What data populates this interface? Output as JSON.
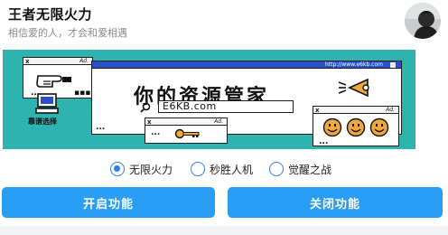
{
  "header": {
    "title": "王者无限火力",
    "subtitle": "相信爱的人，才会和爱相遇"
  },
  "banner": {
    "title": "你的资源管家",
    "url_input": "E6KB.com",
    "url_bar": "http://www.e6kb.com",
    "pc_label": "靠谱选择",
    "ad_label": "Ad.",
    "close_label": "x"
  },
  "modes": {
    "options": [
      "无限火力",
      "秒胜人机",
      "觉醒之战"
    ],
    "selected": "无限火力"
  },
  "actions": {
    "enable_label": "开启功能",
    "disable_label": "关闭功能"
  },
  "colors": {
    "banner_bg": "#2eb3b0",
    "accent": "#2a9df4",
    "radio": "#2f7fea"
  }
}
